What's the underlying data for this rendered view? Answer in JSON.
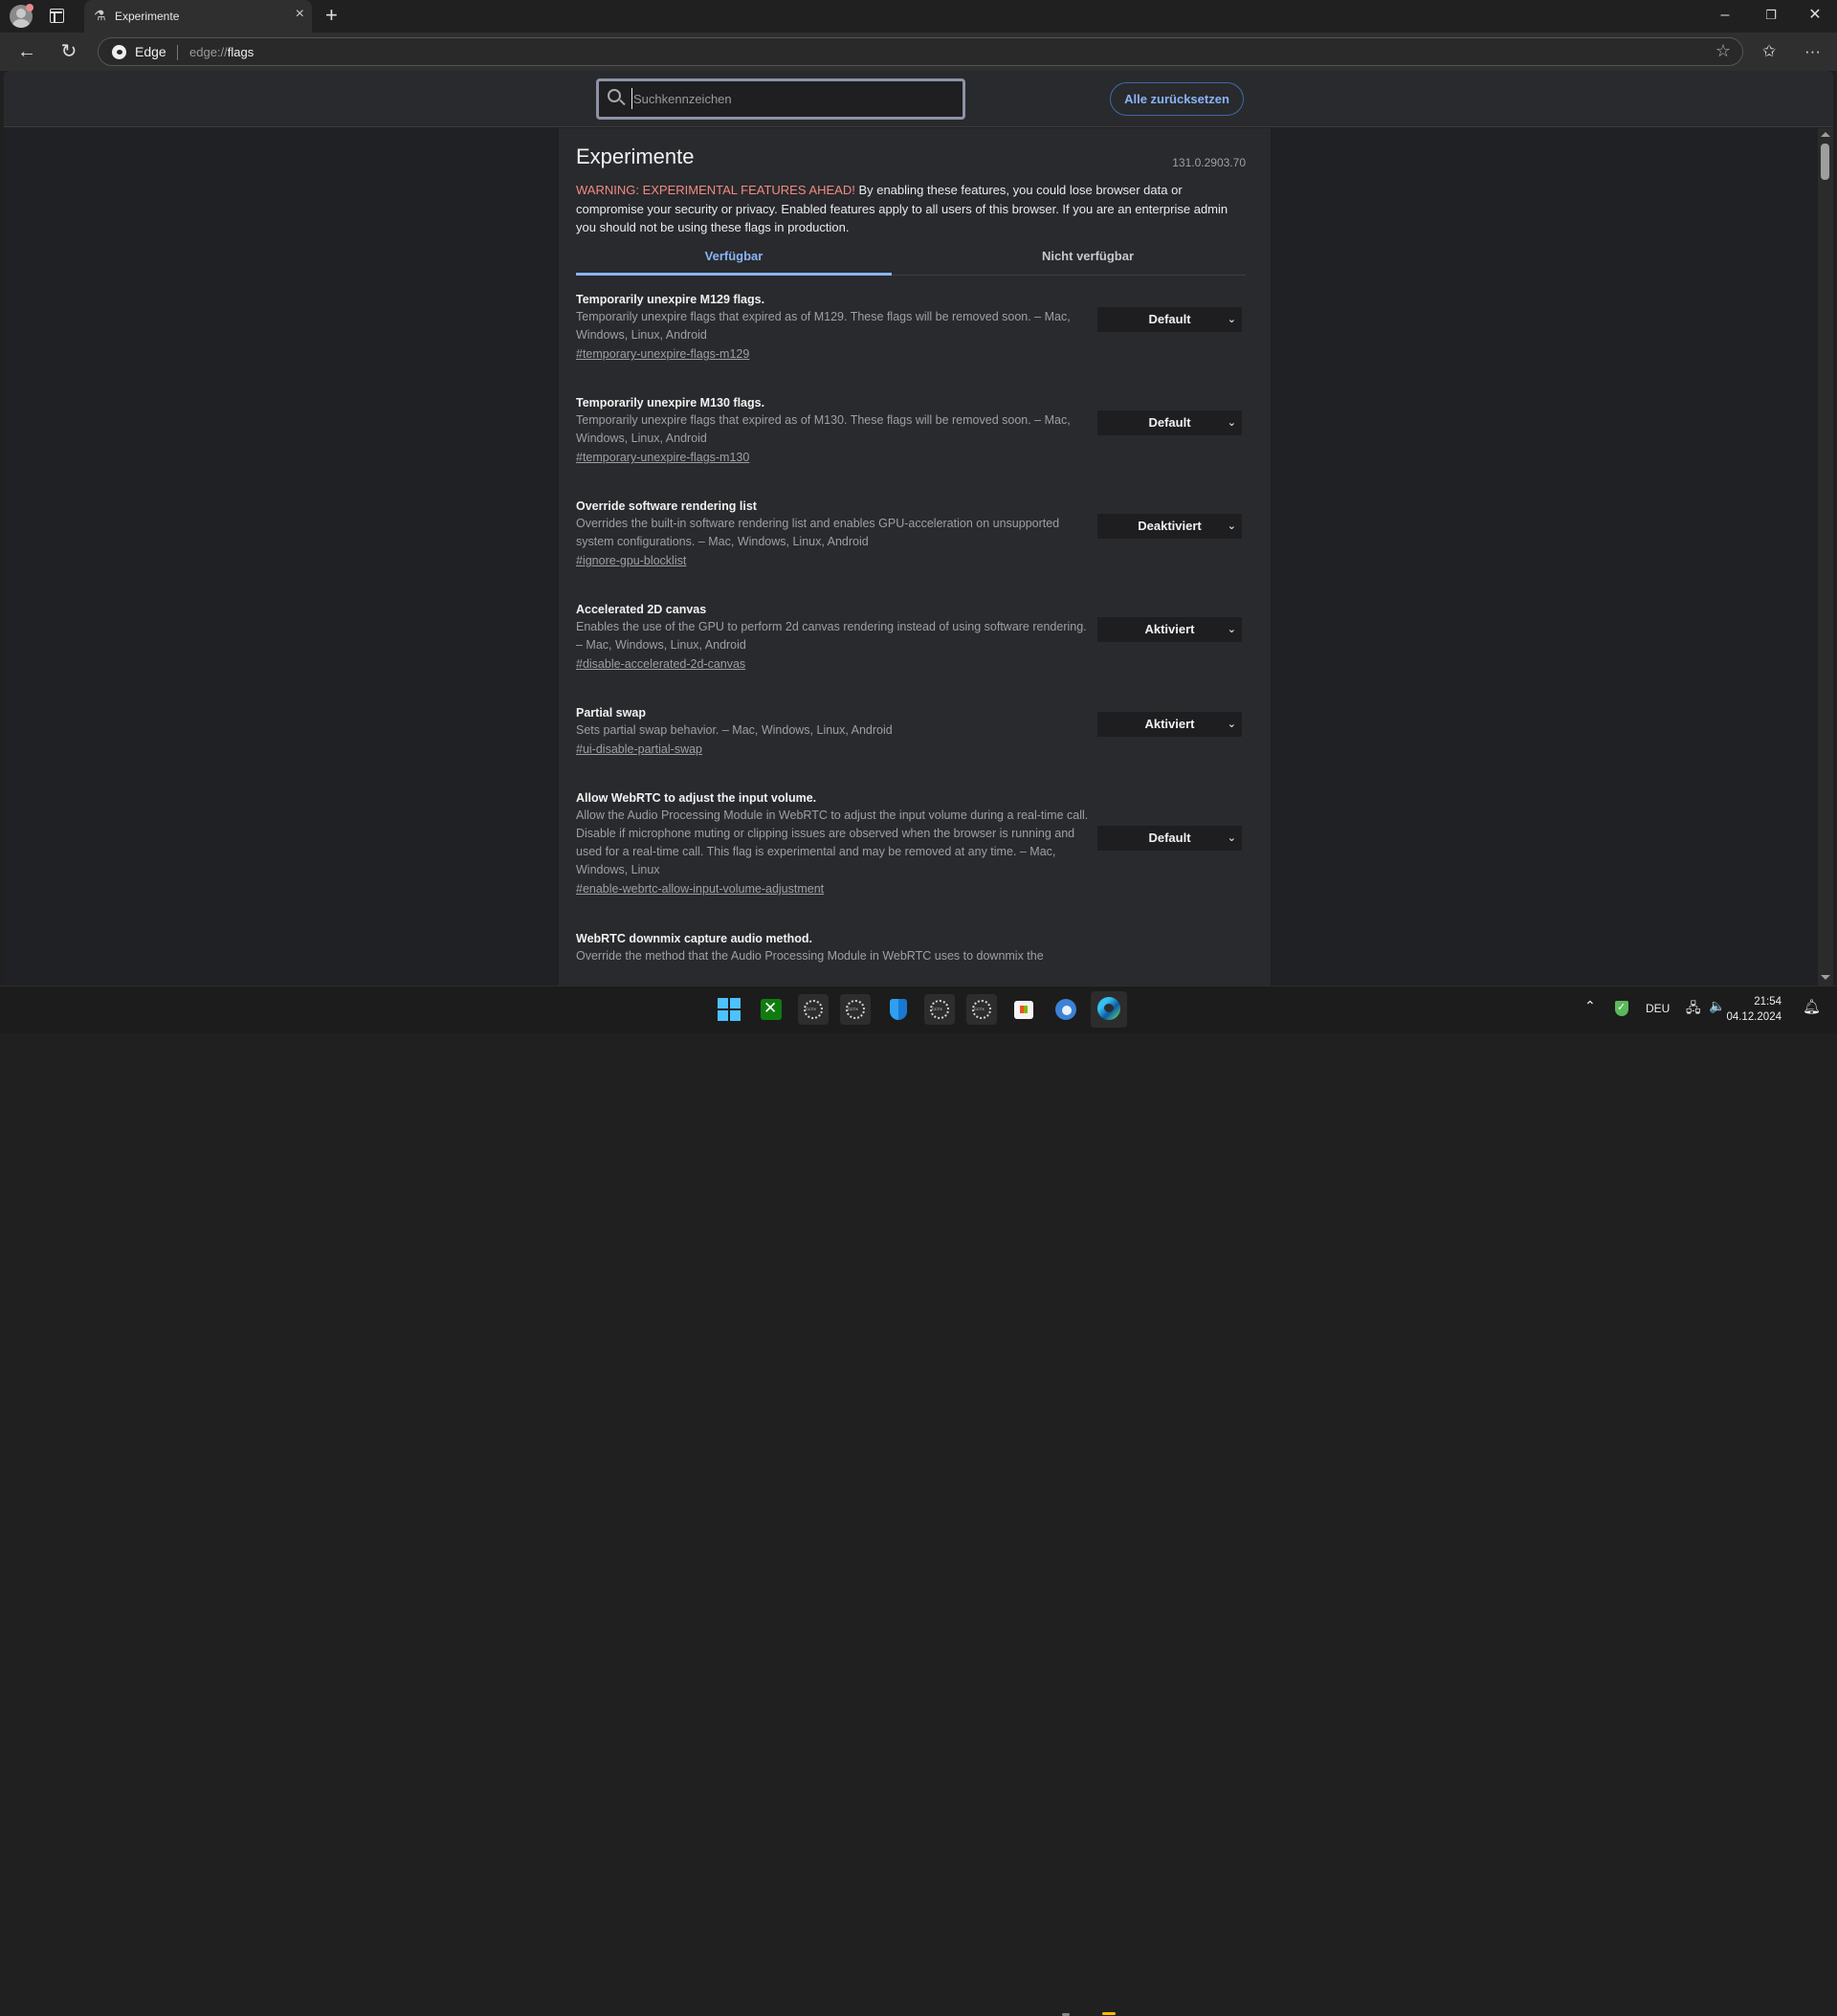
{
  "browser": {
    "tab": {
      "title": "Experimente",
      "icon": "flask-icon"
    },
    "window_controls": {
      "minimize": "–",
      "restore": "❐",
      "close": "✕"
    },
    "address": {
      "brand": "Edge",
      "url_prefix": "edge://",
      "url_host": "flags"
    }
  },
  "page": {
    "search": {
      "placeholder": "Suchkennzeichen",
      "value": ""
    },
    "reset_all_label": "Alle zurücksetzen",
    "title": "Experimente",
    "version": "131.0.2903.70",
    "warning_prefix": "WARNING: EXPERIMENTAL FEATURES AHEAD!",
    "warning_text": " By enabling these features, you could lose browser data or compromise your security or privacy. Enabled features apply to all users of this browser. If you are an enterprise admin you should not be using these flags in production.",
    "tabs": [
      {
        "label": "Verfügbar",
        "active": true
      },
      {
        "label": "Nicht verfügbar",
        "active": false
      }
    ],
    "flags": [
      {
        "name": "Temporarily unexpire M129 flags.",
        "description": "Temporarily unexpire flags that expired as of M129. These flags will be removed soon. – Mac, Windows, Linux, Android",
        "link": "#temporary-unexpire-flags-m129",
        "value": "Default"
      },
      {
        "name": "Temporarily unexpire M130 flags.",
        "description": "Temporarily unexpire flags that expired as of M130. These flags will be removed soon. – Mac, Windows, Linux, Android",
        "link": "#temporary-unexpire-flags-m130",
        "value": "Default"
      },
      {
        "name": "Override software rendering list",
        "description": "Overrides the built-in software rendering list and enables GPU-acceleration on unsupported system configurations. – Mac, Windows, Linux, Android",
        "link": "#ignore-gpu-blocklist",
        "value": "Deaktiviert"
      },
      {
        "name": "Accelerated 2D canvas",
        "description": "Enables the use of the GPU to perform 2d canvas rendering instead of using software rendering. – Mac, Windows, Linux, Android",
        "link": "#disable-accelerated-2d-canvas",
        "value": "Aktiviert"
      },
      {
        "name": "Partial swap",
        "description": "Sets partial swap behavior. – Mac, Windows, Linux, Android",
        "link": "#ui-disable-partial-swap",
        "value": "Aktiviert"
      },
      {
        "name": "Allow WebRTC to adjust the input volume.",
        "description": "Allow the Audio Processing Module in WebRTC to adjust the input volume during a real-time call. Disable if microphone muting or clipping issues are observed when the browser is running and used for a real-time call. This flag is experimental and may be removed at any time. – Mac, Windows, Linux",
        "link": "#enable-webrtc-allow-input-volume-adjustment",
        "value": "Default"
      },
      {
        "name": "WebRTC downmix capture audio method.",
        "description": "Override the method that the Audio Processing Module in WebRTC uses to downmix the",
        "link": "",
        "value": ""
      }
    ]
  },
  "taskbar": {
    "apps": [
      "start-icon",
      "xbox-icon",
      "cctx-icon",
      "cctx-icon",
      "defender-icon",
      "cctx-icon",
      "cctx-icon",
      "store-icon",
      "chrome-icon",
      "edge-icon"
    ],
    "tray": {
      "language": "DEU",
      "time": "21:54",
      "date": "04.12.2024"
    }
  }
}
